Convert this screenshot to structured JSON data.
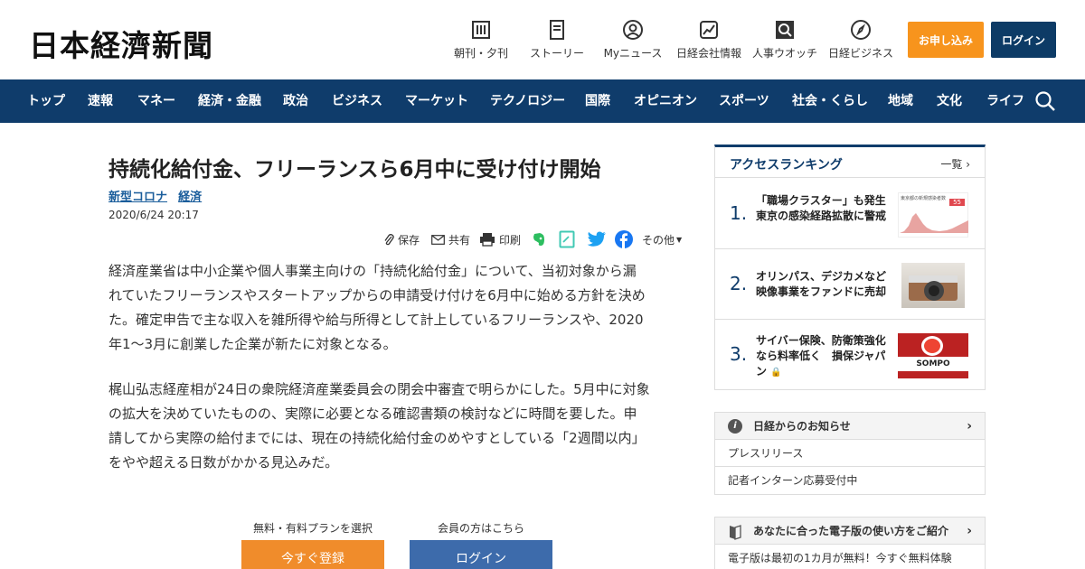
{
  "header": {
    "logo": "日本経濟新聞",
    "nav": [
      {
        "label": "朝刊・夕刊",
        "icon": "newspaper-icon"
      },
      {
        "label": "ストーリー",
        "icon": "story-icon"
      },
      {
        "label": "Myニュース",
        "icon": "user-icon"
      },
      {
        "label": "日経会社情報",
        "icon": "chart-icon"
      },
      {
        "label": "人事ウオッチ",
        "icon": "magnifier-icon"
      },
      {
        "label": "日経ビジネス",
        "icon": "compass-icon"
      }
    ],
    "subscribe_label": "お申し込み",
    "login_label": "ログイン"
  },
  "mainnav": {
    "items": [
      "トップ",
      "速報",
      "マネー",
      "経済・金融",
      "政治",
      "ビジネス",
      "マーケット",
      "テクノロジー",
      "国際",
      "オピニオン",
      "スポーツ",
      "社会・くらし",
      "地域",
      "文化",
      "ライフ"
    ]
  },
  "article": {
    "title": "持続化給付金、フリーランスら6月中に受け付け開始",
    "tags": [
      "新型コロナ",
      "経済"
    ],
    "date": "2020/6/24 20:17",
    "share": {
      "save": "保存",
      "share": "共有",
      "print": "印刷",
      "more": "その他"
    },
    "paragraphs": [
      [
        "経済産業省は中小企業や個人事業主向けの「持続化給付金」について、当初対象から漏",
        "れていたフリーランスやスタートアップからの申請受け付けを6月中に始める方針を決め",
        "た。確定申告で主な収入を雑所得や給与所得として計上しているフリーランスや、2020",
        "年1～3月に創業した企業が新たに対象となる。"
      ],
      [
        "梶山弘志経産相が24日の衆院経済産業委員会の閉会中審査で明らかにした。5月中に対象",
        "の拡大を決めていたものの、実際に必要となる確認書類の検討などに時間を要した。申",
        "請してから実際の給付までには、現在の持続化給付金のめやすとしている「2週間以内」",
        "をやや超える日数がかかる見込みだ。"
      ]
    ],
    "plan_label": "無料・有料プランを選択",
    "member_label": "会員の方はこちら",
    "register_button": "今すぐ登録",
    "login_button": "ログイン"
  },
  "ranking": {
    "title": "アクセスランキング",
    "more": "一覧",
    "items": [
      {
        "rank": "1.",
        "text": "「職場クラスター」も発生　東京の感染経路拡散に警戒"
      },
      {
        "rank": "2.",
        "text": "オリンパス、デジカメなど映像事業をファンドに売却"
      },
      {
        "rank": "3.",
        "text": "サイバー保険、防衛策強化なら料率低く　損保ジャパン"
      }
    ],
    "thumb1_title": "東京都の新規感染者数",
    "thumb1_value": "55",
    "thumb3_brand": "SOMPO"
  },
  "notice": {
    "title": "日経からのお知らせ",
    "items": [
      "プレスリリース",
      "記者インターン応募受付中"
    ]
  },
  "guide": {
    "title": "あなたに合った電子版の使い方をご紹介",
    "text": "電子版は最初の1カ月が無料！今すぐ無料体験"
  },
  "colors": {
    "navy": "#0f3c6b",
    "orange": "#f7941d",
    "link": "#1a5d9b"
  }
}
